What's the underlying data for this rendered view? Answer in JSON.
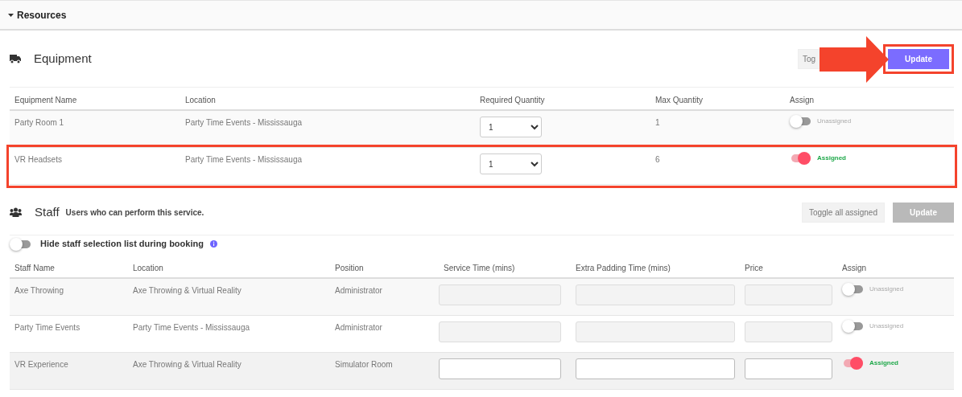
{
  "section": {
    "title": "Resources",
    "expanded": true
  },
  "equipment": {
    "title": "Equipment",
    "toggle_button": "Tog",
    "update_button": {
      "label": "Update",
      "disabled": false,
      "highlighted": true
    },
    "columns": [
      "Equipment Name",
      "Location",
      "Required Quantity",
      "Max Quantity",
      "Assign"
    ],
    "rows": [
      {
        "name": "Party Room 1",
        "location": "Party Time Events - Mississauga",
        "required_quantity": "1",
        "max_quantity": "1",
        "assigned": false,
        "assign_label": "Unassigned",
        "highlighted": false
      },
      {
        "name": "VR Headsets",
        "location": "Party Time Events - Mississauga",
        "required_quantity": "1",
        "max_quantity": "6",
        "assigned": true,
        "assign_label": "Assigned",
        "highlighted": true
      }
    ]
  },
  "staff": {
    "title": "Staff",
    "subtitle": "Users who can perform this service.",
    "toggle_button": "Toggle all assigned",
    "update_button": {
      "label": "Update",
      "disabled": true,
      "highlighted": false
    },
    "hide_list": {
      "label": "Hide staff selection list during booking",
      "on": false
    },
    "columns": [
      "Staff Name",
      "Location",
      "Position",
      "Service Time (mins)",
      "Extra Padding Time (mins)",
      "Price",
      "Assign"
    ],
    "rows": [
      {
        "name": "Axe Throwing",
        "location": "Axe Throwing & Virtual Reality",
        "position": "Administrator",
        "assigned": false,
        "assign_label": "Unassigned"
      },
      {
        "name": "Party Time Events",
        "location": "Party Time Events - Mississauga",
        "position": "Administrator",
        "assigned": false,
        "assign_label": "Unassigned"
      },
      {
        "name": "VR Experience",
        "location": "Axe Throwing & Virtual Reality",
        "position": "Simulator Room",
        "assigned": true,
        "assign_label": "Assigned"
      }
    ]
  }
}
